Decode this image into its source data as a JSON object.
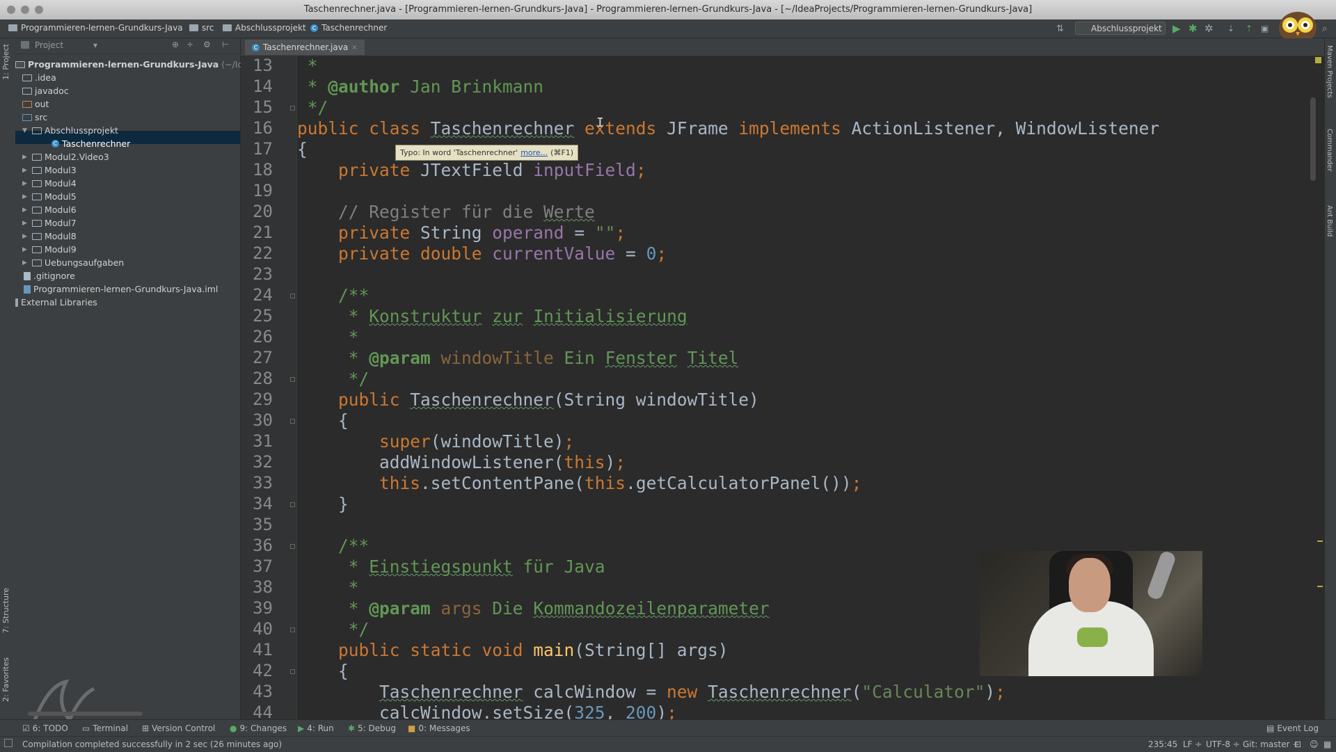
{
  "window": {
    "title": "Taschenrechner.java - [Programmieren-lernen-Grundkurs-Java] - Programmieren-lernen-Grundkurs-Java - [~/IdeaProjects/Programmieren-lernen-Grundkurs-Java]"
  },
  "breadcrumbs": [
    "Programmieren-lernen-Grundkurs-Java",
    "src",
    "Abschlussprojekt",
    "Taschenrechner"
  ],
  "run_config": {
    "label": "Abschlussprojekt"
  },
  "side_tabs": {
    "left": [
      "1: Project",
      "7: Structure",
      "2: Favorites"
    ],
    "right": [
      "Maven Projects",
      "Commander",
      "Ant Build"
    ]
  },
  "project_panel": {
    "header": "Project",
    "root_name": "Programmieren-lernen-Grundkurs-Java",
    "root_path": "(~/IdeaPr",
    "items": [
      {
        "label": ".idea"
      },
      {
        "label": "javadoc"
      },
      {
        "label": "out"
      },
      {
        "label": "src"
      },
      {
        "label": "Abschlussprojekt"
      },
      {
        "label": "Taschenrechner"
      },
      {
        "label": "Modul2.Video3"
      },
      {
        "label": "Modul3"
      },
      {
        "label": "Modul4"
      },
      {
        "label": "Modul5"
      },
      {
        "label": "Modul6"
      },
      {
        "label": "Modul7"
      },
      {
        "label": "Modul8"
      },
      {
        "label": "Modul9"
      },
      {
        "label": "Uebungsaufgaben"
      },
      {
        "label": ".gitignore"
      },
      {
        "label": "Programmieren-lernen-Grundkurs-Java.iml"
      },
      {
        "label": "External Libraries"
      }
    ]
  },
  "editor": {
    "tab_label": "Taschenrechner.java",
    "line_numbers": [
      "13",
      "14",
      "15",
      "16",
      "17",
      "18",
      "19",
      "20",
      "21",
      "22",
      "23",
      "24",
      "25",
      "26",
      "27",
      "28",
      "29",
      "30",
      "31",
      "32",
      "33",
      "34",
      "35",
      "36",
      "37",
      "38",
      "39",
      "40",
      "41",
      "42",
      "43",
      "44"
    ],
    "tooltip": {
      "text": "Typo: In word 'Taschenrechner'",
      "link": "more...",
      "shortcut": "(⌘F1)"
    }
  },
  "bottom_tools": [
    {
      "label": "6: TODO"
    },
    {
      "label": "Terminal"
    },
    {
      "label": "Version Control"
    },
    {
      "label": "9: Changes"
    },
    {
      "label": "4: Run"
    },
    {
      "label": "5: Debug"
    },
    {
      "label": "0: Messages"
    },
    {
      "label": "Event Log"
    }
  ],
  "status": {
    "message": "Compilation completed successfully in 2 sec (26 minutes ago)",
    "position": "235:45",
    "line_sep": "LF ÷",
    "encoding": "UTF-8 ÷",
    "git": "Git: master ÷"
  },
  "colors": {
    "editor_bg": "#2b2b2b",
    "keyword": "#cc7832",
    "field": "#9876aa",
    "number": "#6897bb",
    "string": "#6a8759",
    "doc_comment": "#629755",
    "selection": "#0d293e"
  }
}
